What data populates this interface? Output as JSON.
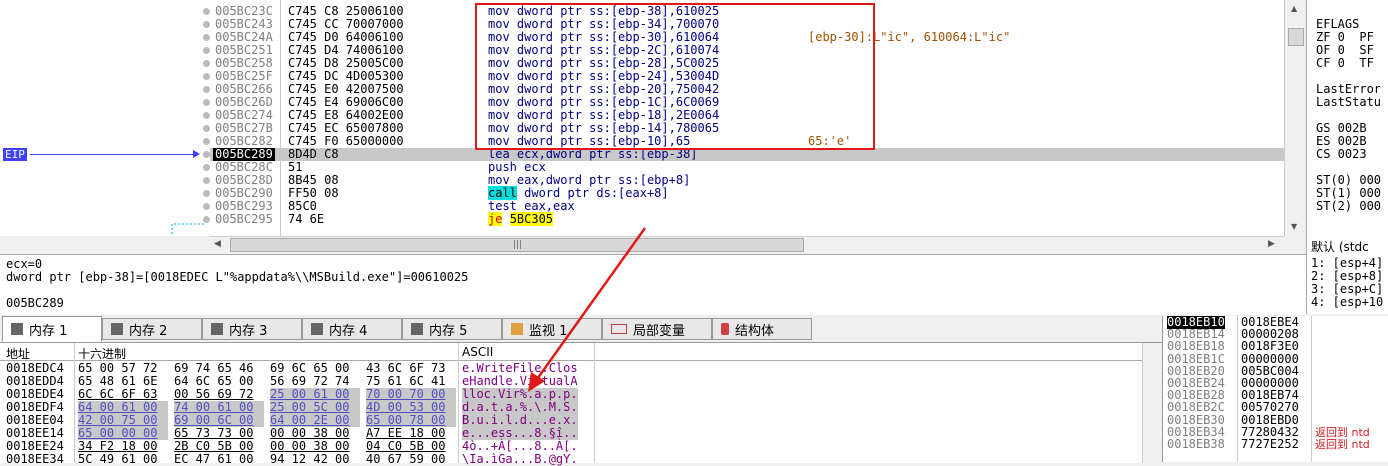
{
  "disasm": {
    "rows": [
      {
        "addr": "005BC23C",
        "bytes": "C745 C8 25006100",
        "instr": "mov dword ptr ss:[ebp-38],610025",
        "comment": ""
      },
      {
        "addr": "005BC243",
        "bytes": "C745 CC 70007000",
        "instr": "mov dword ptr ss:[ebp-34],700070",
        "comment": ""
      },
      {
        "addr": "005BC24A",
        "bytes": "C745 D0 64006100",
        "instr": "mov dword ptr ss:[ebp-30],610064",
        "comment": "[ebp-30]:L\"ic\", 610064:L\"ic\""
      },
      {
        "addr": "005BC251",
        "bytes": "C745 D4 74006100",
        "instr": "mov dword ptr ss:[ebp-2C],610074",
        "comment": ""
      },
      {
        "addr": "005BC258",
        "bytes": "C745 D8 25005C00",
        "instr": "mov dword ptr ss:[ebp-28],5C0025",
        "comment": ""
      },
      {
        "addr": "005BC25F",
        "bytes": "C745 DC 4D005300",
        "instr": "mov dword ptr ss:[ebp-24],53004D",
        "comment": ""
      },
      {
        "addr": "005BC266",
        "bytes": "C745 E0 42007500",
        "instr": "mov dword ptr ss:[ebp-20],750042",
        "comment": ""
      },
      {
        "addr": "005BC26D",
        "bytes": "C745 E4 69006C00",
        "instr": "mov dword ptr ss:[ebp-1C],6C0069",
        "comment": ""
      },
      {
        "addr": "005BC274",
        "bytes": "C745 E8 64002E00",
        "instr": "mov dword ptr ss:[ebp-18],2E0064",
        "comment": ""
      },
      {
        "addr": "005BC27B",
        "bytes": "C745 EC 65007800",
        "instr": "mov dword ptr ss:[ebp-14],780065",
        "comment": ""
      },
      {
        "addr": "005BC282",
        "bytes": "C745 F0 65000000",
        "instr": "mov dword ptr ss:[ebp-10],65",
        "comment": "65:'e'"
      },
      {
        "addr": "005BC289",
        "bytes": "8D4D C8",
        "instr": "lea ecx,dword ptr ss:[ebp-38]",
        "comment": ""
      },
      {
        "addr": "005BC28C",
        "bytes": "51",
        "instr": "push ecx",
        "comment": ""
      },
      {
        "addr": "005BC28D",
        "bytes": "8B45 08",
        "instr": "mov eax,dword ptr ss:[ebp+8]",
        "comment": ""
      },
      {
        "addr": "005BC290",
        "bytes": "FF50 08",
        "instr": "call dword ptr ds:[eax+8]",
        "comment": ""
      },
      {
        "addr": "005BC293",
        "bytes": "85C0",
        "instr": "test eax,eax",
        "comment": ""
      },
      {
        "addr": "005BC295",
        "bytes": "74 6E",
        "instr": "je 5BC305",
        "comment": ""
      }
    ],
    "eip_label": "EIP",
    "current_index": 11
  },
  "registers": {
    "lines": [
      "EFLAGS",
      "ZF 0  PF",
      "OF 0  SF",
      "CF 0  TF",
      "",
      "LastError",
      "LastStatu",
      "",
      "GS 002B",
      "ES 002B",
      "CS 0023",
      "",
      "ST(0) 000",
      "ST(1) 000",
      "ST(2) 000"
    ]
  },
  "info": {
    "line1": "ecx=0",
    "line2": "dword ptr [ebp-38]=[0018EDEC L\"%appdata%\\\\MSBuild.exe\"]=00610025",
    "line3": "005BC289"
  },
  "right_stack_header": "默认 (stdc",
  "right_stack_lines": [
    "1: [esp+4]",
    "2: [esp+8]",
    "3: [esp+C]",
    "4: [esp+10"
  ],
  "tabs": [
    {
      "label": "内存 1",
      "icon": "memory-icon"
    },
    {
      "label": "内存 2",
      "icon": "memory-icon"
    },
    {
      "label": "内存 3",
      "icon": "memory-icon"
    },
    {
      "label": "内存 4",
      "icon": "memory-icon"
    },
    {
      "label": "内存 5",
      "icon": "memory-icon"
    },
    {
      "label": "监视 1",
      "icon": "watch-icon"
    },
    {
      "label": "局部变量",
      "icon": "locals-icon"
    },
    {
      "label": "结构体",
      "icon": "struct-icon"
    }
  ],
  "dump": {
    "header_addr": "地址",
    "header_hex": "十六进制",
    "header_ascii": "ASCII",
    "rows": [
      {
        "addr": "0018EDC4",
        "h1": "65 00 57 72",
        "h2": "69 74 65 46",
        "h3": "69 6C 65 00",
        "h4": "43 6C 6F 73",
        "ascii": "e.WriteFile.Clos"
      },
      {
        "addr": "0018EDD4",
        "h1": "65 48 61 6E",
        "h2": "64 6C 65 00",
        "h3": "56 69 72 74",
        "h4": "75 61 6C 41",
        "ascii": "eHandle.VirtualA"
      },
      {
        "addr": "0018EDE4",
        "h1": "6C 6C 6F 63",
        "h2": "00 56 69 72",
        "h3": "25 00 61 00",
        "h4": "70 00 70 00",
        "ascii": "lloc.Vir%.a.p.p."
      },
      {
        "addr": "0018EDF4",
        "h1": "64 00 61 00",
        "h2": "74 00 61 00",
        "h3": "25 00 5C 00",
        "h4": "4D 00 53 00",
        "ascii": "d.a.t.a.%.\\.M.S."
      },
      {
        "addr": "0018EE04",
        "h1": "42 00 75 00",
        "h2": "69 00 6C 00",
        "h3": "64 00 2E 00",
        "h4": "65 00 78 00",
        "ascii": "B.u.i.l.d...e.x."
      },
      {
        "addr": "0018EE14",
        "h1": "65 00 00 00",
        "h2": "65 73 73 00",
        "h3": "00 00 38 00",
        "h4": "A7 EE 18 00",
        "ascii": "e...ess...8.§î.."
      },
      {
        "addr": "0018EE24",
        "h1": "34 F2 18 00",
        "h2": "2B C0 5B 00",
        "h3": "00 00 38 00",
        "h4": "04 C0 5B 00",
        "ascii": "4ò..+À[...8..À[."
      },
      {
        "addr": "0018EE34",
        "h1": "5C 49 61 00",
        "h2": "EC 47 61 00",
        "h3": "94 12 42 00",
        "h4": "40 67 59 00",
        "ascii": "\\Ia.ìGa...B.@gY."
      }
    ]
  },
  "stack": {
    "rows": [
      {
        "addr": "0018EB10",
        "val": "0018EBE4",
        "cmt": ""
      },
      {
        "addr": "0018EB14",
        "val": "00000208",
        "cmt": ""
      },
      {
        "addr": "0018EB18",
        "val": "0018F3E0",
        "cmt": ""
      },
      {
        "addr": "0018EB1C",
        "val": "00000000",
        "cmt": ""
      },
      {
        "addr": "0018EB20",
        "val": "005BC004",
        "cmt": ""
      },
      {
        "addr": "0018EB24",
        "val": "00000000",
        "cmt": ""
      },
      {
        "addr": "0018EB28",
        "val": "0018EB74",
        "cmt": ""
      },
      {
        "addr": "0018EB2C",
        "val": "00570270",
        "cmt": ""
      },
      {
        "addr": "0018EB30",
        "val": "0018EBD0",
        "cmt": ""
      },
      {
        "addr": "0018EB34",
        "val": "77280432",
        "cmt": "返回到 ntd"
      },
      {
        "addr": "0018EB38",
        "val": "7727E252",
        "cmt": "返回到 ntd"
      }
    ]
  },
  "colors": {
    "highlight_box": "#e01818",
    "eip": "#4040ff",
    "call_bg": "#00e0e0",
    "je_bg": "#ffff00"
  }
}
